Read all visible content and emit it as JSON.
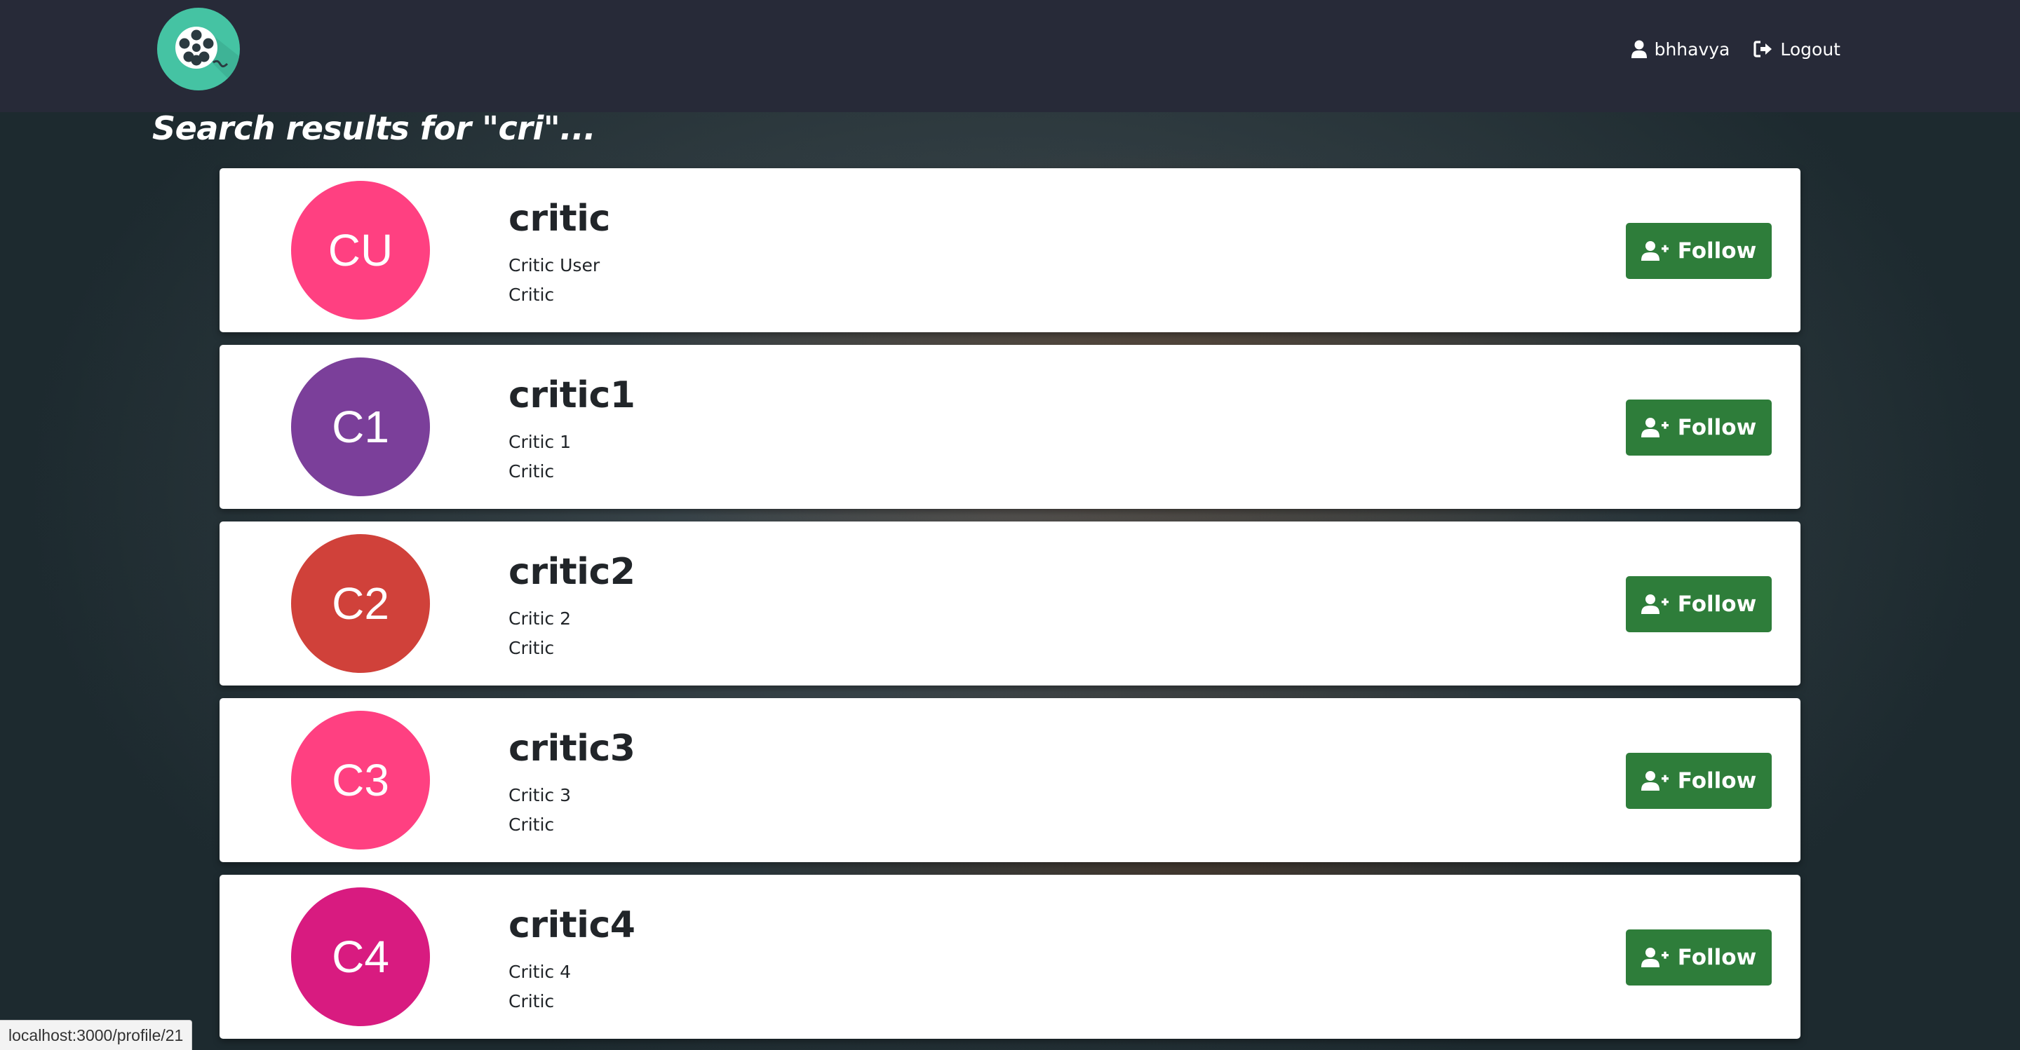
{
  "nav": {
    "logo_icon": "film-reel-icon",
    "username": "bhhavya",
    "user_icon": "user-icon",
    "logout_label": "Logout",
    "logout_icon": "sign-out-icon"
  },
  "search": {
    "title": "Search results for \"cri\"..."
  },
  "results": [
    {
      "initials": "CU",
      "avatar_color": "#ff4081",
      "username": "critic",
      "full_name": "Critic User",
      "role": "Critic",
      "follow_label": "Follow"
    },
    {
      "initials": "C1",
      "avatar_color": "#7b3f9a",
      "username": "critic1",
      "full_name": "Critic 1",
      "role": "Critic",
      "follow_label": "Follow"
    },
    {
      "initials": "C2",
      "avatar_color": "#d0413a",
      "username": "critic2",
      "full_name": "Critic 2",
      "role": "Critic",
      "follow_label": "Follow"
    },
    {
      "initials": "C3",
      "avatar_color": "#ff4081",
      "username": "critic3",
      "full_name": "Critic 3",
      "role": "Critic",
      "follow_label": "Follow"
    },
    {
      "initials": "C4",
      "avatar_color": "#d81b80",
      "username": "critic4",
      "full_name": "Critic 4",
      "role": "Critic",
      "follow_label": "Follow"
    }
  ],
  "colors": {
    "navbar": "#272a38",
    "follow_button": "#2e7d3a",
    "logo": "#45c3a3"
  },
  "status_bar": {
    "url": "localhost:3000/profile/21"
  }
}
